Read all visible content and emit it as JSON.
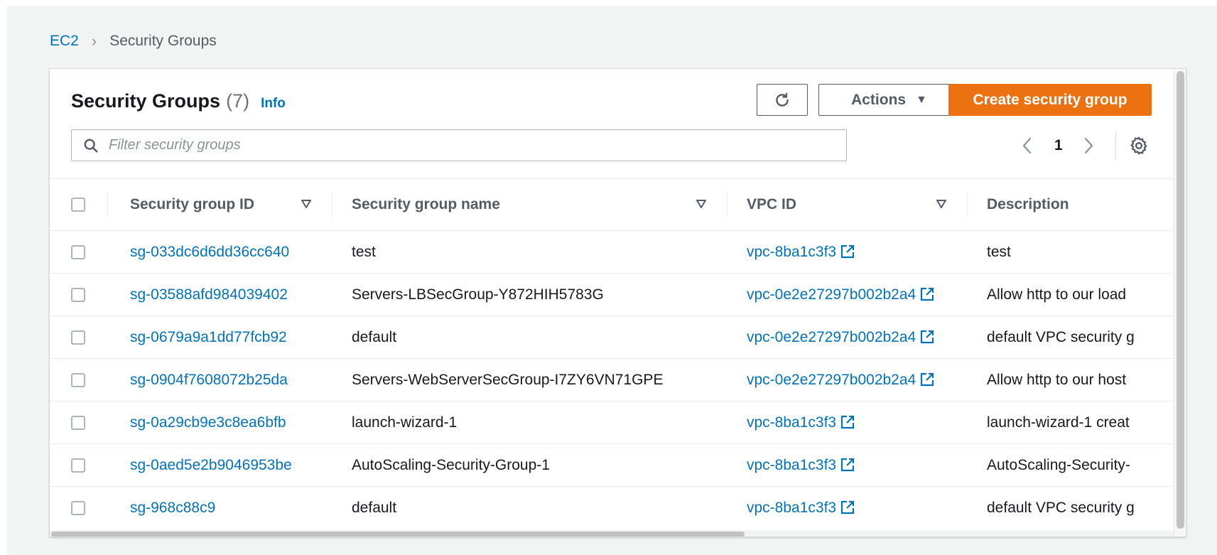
{
  "breadcrumb": {
    "root": "EC2",
    "separator": "›",
    "current": "Security Groups"
  },
  "panel": {
    "title": "Security Groups",
    "count": "(7)",
    "info": "Info"
  },
  "toolbar": {
    "refresh_icon": "refresh-icon",
    "actions_label": "Actions",
    "actions_caret": "▼",
    "create_label": "Create security group"
  },
  "search": {
    "placeholder": "Filter security groups",
    "value": ""
  },
  "pagination": {
    "prev": "‹",
    "page": "1",
    "next": "›"
  },
  "table": {
    "headers": {
      "id": "Security group ID",
      "name": "Security group name",
      "vpc": "VPC ID",
      "description": "Description"
    },
    "rows": [
      {
        "id": "sg-033dc6d6dd36cc640",
        "name": "test",
        "vpc": "vpc-8ba1c3f3",
        "description": "test"
      },
      {
        "id": "sg-03588afd984039402",
        "name": "Servers-LBSecGroup-Y872HIH5783G",
        "vpc": "vpc-0e2e27297b002b2a4",
        "description": "Allow http to our load"
      },
      {
        "id": "sg-0679a9a1dd77fcb92",
        "name": "default",
        "vpc": "vpc-0e2e27297b002b2a4",
        "description": "default VPC security g"
      },
      {
        "id": "sg-0904f7608072b25da",
        "name": "Servers-WebServerSecGroup-I7ZY6VN71GPE",
        "vpc": "vpc-0e2e27297b002b2a4",
        "description": "Allow http to our host"
      },
      {
        "id": "sg-0a29cb9e3c8ea6bfb",
        "name": "launch-wizard-1",
        "vpc": "vpc-8ba1c3f3",
        "description": "launch-wizard-1 creat"
      },
      {
        "id": "sg-0aed5e2b9046953be",
        "name": "AutoScaling-Security-Group-1",
        "vpc": "vpc-8ba1c3f3",
        "description": "AutoScaling-Security-"
      },
      {
        "id": "sg-968c88c9",
        "name": "default",
        "vpc": "vpc-8ba1c3f3",
        "description": "default VPC security g"
      }
    ]
  },
  "colors": {
    "link": "#0073bb",
    "primary": "#ec7211",
    "text": "#16191f",
    "muted": "#545b64"
  }
}
